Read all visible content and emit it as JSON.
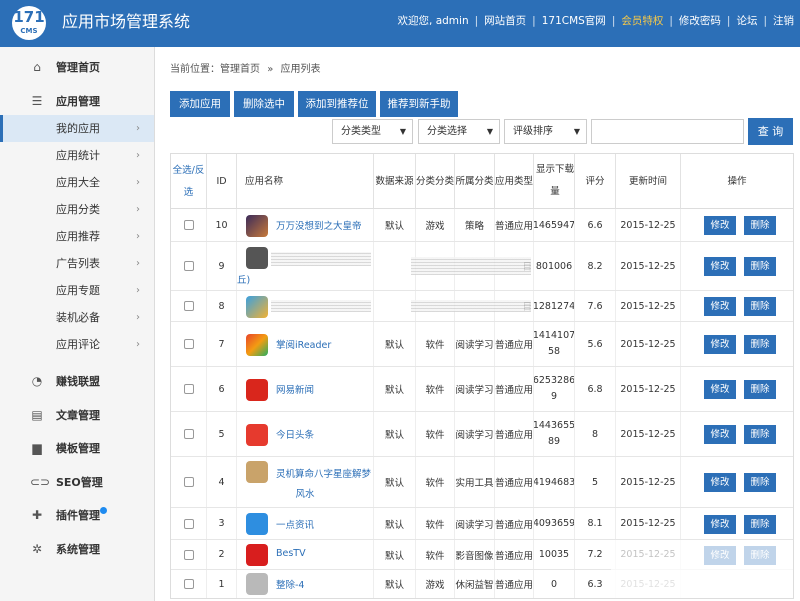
{
  "header": {
    "logo_top": "171",
    "logo_bottom": "CMS",
    "title": "应用市场管理系统",
    "nav": [
      "欢迎您, admin",
      "网站首页",
      "171CMS官网",
      "会员特权",
      "修改密码",
      "论坛",
      "注销"
    ],
    "vip_color": "#f7c948",
    "accent": "#2c6fb7"
  },
  "sidebar": {
    "items": [
      {
        "label": "管理首页",
        "icon": "home-icon"
      },
      {
        "label": "应用管理",
        "icon": "menu-icon"
      },
      {
        "label": "我的应用"
      },
      {
        "label": "应用统计"
      },
      {
        "label": "应用大全"
      },
      {
        "label": "应用分类"
      },
      {
        "label": "应用推荐"
      },
      {
        "label": "广告列表"
      },
      {
        "label": "应用专题"
      },
      {
        "label": "装机必备"
      },
      {
        "label": "应用评论"
      },
      {
        "label": "赚钱联盟",
        "icon": "pie-icon"
      },
      {
        "label": "文章管理",
        "icon": "document-icon"
      },
      {
        "label": "模板管理",
        "icon": "folder-icon"
      },
      {
        "label": "SEO管理",
        "icon": "link-icon"
      },
      {
        "label": "插件管理",
        "icon": "puzzle-icon"
      },
      {
        "label": "系统管理",
        "icon": "gear-icon"
      }
    ]
  },
  "breadcrumb": {
    "prefix": "当前位置：",
    "home": "管理首页",
    "sep": "»",
    "current": "应用列表"
  },
  "toolbar": {
    "buttons": [
      "添加应用",
      "删除选中",
      "添加到推荐位",
      "推荐到新手助"
    ],
    "filters": [
      "分类类型",
      "分类选择",
      "评级排序"
    ],
    "search_value": "",
    "search_label": "查 询"
  },
  "table": {
    "headers": {
      "select_all": "全选/反选",
      "id": "ID",
      "name": "应用名称",
      "source": "数据来源",
      "category_type": "分类分类",
      "category": "所属分类",
      "app_type": "应用类型",
      "downloads": "显示下载量",
      "rating": "评分",
      "updated": "更新时间",
      "actions": "操作"
    },
    "edit_label": "修改",
    "delete_label": "删除",
    "rows": [
      {
        "id": "10",
        "name": "万万没想到之大皇帝",
        "source": "默认",
        "ctype": "游戏",
        "cat": "策略",
        "atype": "普通应用",
        "dl": "1465947",
        "rating": "6.6",
        "date": "2015-12-25"
      },
      {
        "id": "9",
        "name": "丘)",
        "source": "",
        "ctype": "",
        "cat": "",
        "atype": "目",
        "dl": "801006",
        "rating": "8.2",
        "date": "2015-12-25"
      },
      {
        "id": "8",
        "name": "",
        "source": "",
        "ctype": "",
        "cat": "",
        "atype": "目",
        "dl": "1281274",
        "rating": "7.6",
        "date": "2015-12-25"
      },
      {
        "id": "7",
        "name": "掌阅iReader",
        "source": "默认",
        "ctype": "软件",
        "cat": "阅读学习",
        "atype": "普通应用",
        "dl": "1414107\n58",
        "rating": "5.6",
        "date": "2015-12-25"
      },
      {
        "id": "6",
        "name": "网易新闻",
        "source": "默认",
        "ctype": "软件",
        "cat": "阅读学习",
        "atype": "普通应用",
        "dl": "6253286\n9",
        "rating": "6.8",
        "date": "2015-12-25"
      },
      {
        "id": "5",
        "name": "今日头条",
        "source": "默认",
        "ctype": "软件",
        "cat": "阅读学习",
        "atype": "普通应用",
        "dl": "1443655\n89",
        "rating": "8",
        "date": "2015-12-25"
      },
      {
        "id": "4",
        "name": "灵机算命八字星座解梦\n风水",
        "source": "默认",
        "ctype": "软件",
        "cat": "实用工具",
        "atype": "普通应用",
        "dl": "4194683",
        "rating": "5",
        "date": "2015-12-25"
      },
      {
        "id": "3",
        "name": "一点资讯",
        "source": "默认",
        "ctype": "软件",
        "cat": "阅读学习",
        "atype": "普通应用",
        "dl": "4093659",
        "rating": "8.1",
        "date": "2015-12-25"
      },
      {
        "id": "2",
        "name": "BesTV",
        "source": "默认",
        "ctype": "软件",
        "cat": "影音图像",
        "atype": "普通应用",
        "dl": "10035",
        "rating": "7.2",
        "date": "2015-12-25"
      },
      {
        "id": "1",
        "name": "整除-4",
        "source": "默认",
        "ctype": "游戏",
        "cat": "休闲益智",
        "atype": "普通应用",
        "dl": "0",
        "rating": "6.3",
        "date": "2015-12-25"
      }
    ]
  }
}
